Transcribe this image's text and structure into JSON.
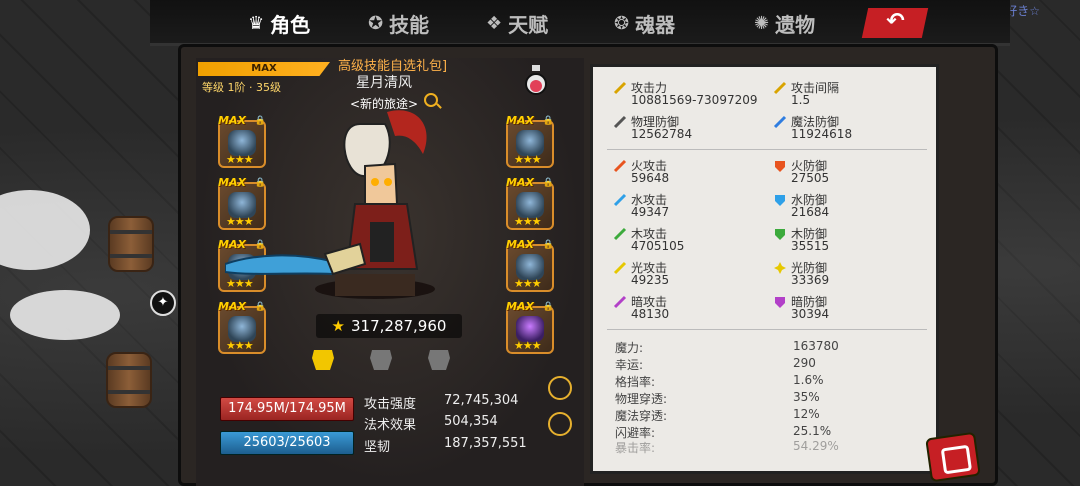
{
  "header": {
    "user_label": "大好き☆",
    "tabs": [
      {
        "label": "角色",
        "icon": "crown-icon",
        "glyph": "♛"
      },
      {
        "label": "技能",
        "icon": "skill-icon",
        "glyph": "✪"
      },
      {
        "label": "天赋",
        "icon": "talent-icon",
        "glyph": "❖"
      },
      {
        "label": "魂器",
        "icon": "soul-icon",
        "glyph": "❂"
      },
      {
        "label": "遗物",
        "icon": "relic-icon",
        "glyph": "✺"
      }
    ],
    "back_glyph": "↶"
  },
  "character": {
    "max_label": "MAX",
    "level_text": "等级 1阶 · 35级",
    "pack_label": "高级技能自选礼包]",
    "name": "星月清风",
    "title": "<新的旅途>",
    "power_star": "★",
    "power": "317,287,960",
    "hp": "174.95M/174.95M",
    "mp": "25603/25603",
    "combat_stats": [
      {
        "label": "攻击强度",
        "value": "72,745,304"
      },
      {
        "label": "法术效果",
        "value": "504,354"
      },
      {
        "label": "坚韧",
        "value": "187,357,551"
      }
    ],
    "slot_max": "MAX",
    "slot_lock": "🔒",
    "slot_stars": "★★★"
  },
  "stats": {
    "primary": [
      {
        "label": "攻击力",
        "value": "10881569-73097209",
        "icon": "sword-icon",
        "color": "#d9a400"
      },
      {
        "label": "攻击间隔",
        "value": "1.5",
        "icon": "speed-sword-icon",
        "color": "#d9a400"
      },
      {
        "label": "物理防御",
        "value": "12562784",
        "icon": "physical-defense-icon",
        "color": "#555555"
      },
      {
        "label": "魔法防御",
        "value": "11924618",
        "icon": "magic-defense-icon",
        "color": "#2f7de0"
      }
    ],
    "elements": [
      {
        "label": "火攻击",
        "value": "59648",
        "icon": "fire-attack-icon",
        "color": "#e8541f"
      },
      {
        "label": "火防御",
        "value": "27505",
        "icon": "fire-defense-icon",
        "color": "#e8541f"
      },
      {
        "label": "水攻击",
        "value": "49347",
        "icon": "water-attack-icon",
        "color": "#2ea0e8"
      },
      {
        "label": "水防御",
        "value": "21684",
        "icon": "water-defense-icon",
        "color": "#2ea0e8"
      },
      {
        "label": "木攻击",
        "value": "4705105",
        "icon": "wood-attack-icon",
        "color": "#3caa3c"
      },
      {
        "label": "木防御",
        "value": "35515",
        "icon": "wood-defense-icon",
        "color": "#3caa3c"
      },
      {
        "label": "光攻击",
        "value": "49235",
        "icon": "light-attack-icon",
        "color": "#e6c800"
      },
      {
        "label": "光防御",
        "value": "33369",
        "icon": "light-defense-icon",
        "color": "#e6c800"
      },
      {
        "label": "暗攻击",
        "value": "48130",
        "icon": "dark-attack-icon",
        "color": "#b240c8"
      },
      {
        "label": "暗防御",
        "value": "30394",
        "icon": "dark-defense-icon",
        "color": "#b240c8"
      }
    ],
    "misc": [
      {
        "label": "魔力:",
        "value": "163780"
      },
      {
        "label": "幸运:",
        "value": "290"
      },
      {
        "label": "格挡率:",
        "value": "1.6%"
      },
      {
        "label": "物理穿透:",
        "value": "35%"
      },
      {
        "label": "魔法穿透:",
        "value": "12%"
      },
      {
        "label": "闪避率:",
        "value": "25.1%"
      },
      {
        "label": "暴击率:",
        "value": "54.29%"
      }
    ]
  }
}
